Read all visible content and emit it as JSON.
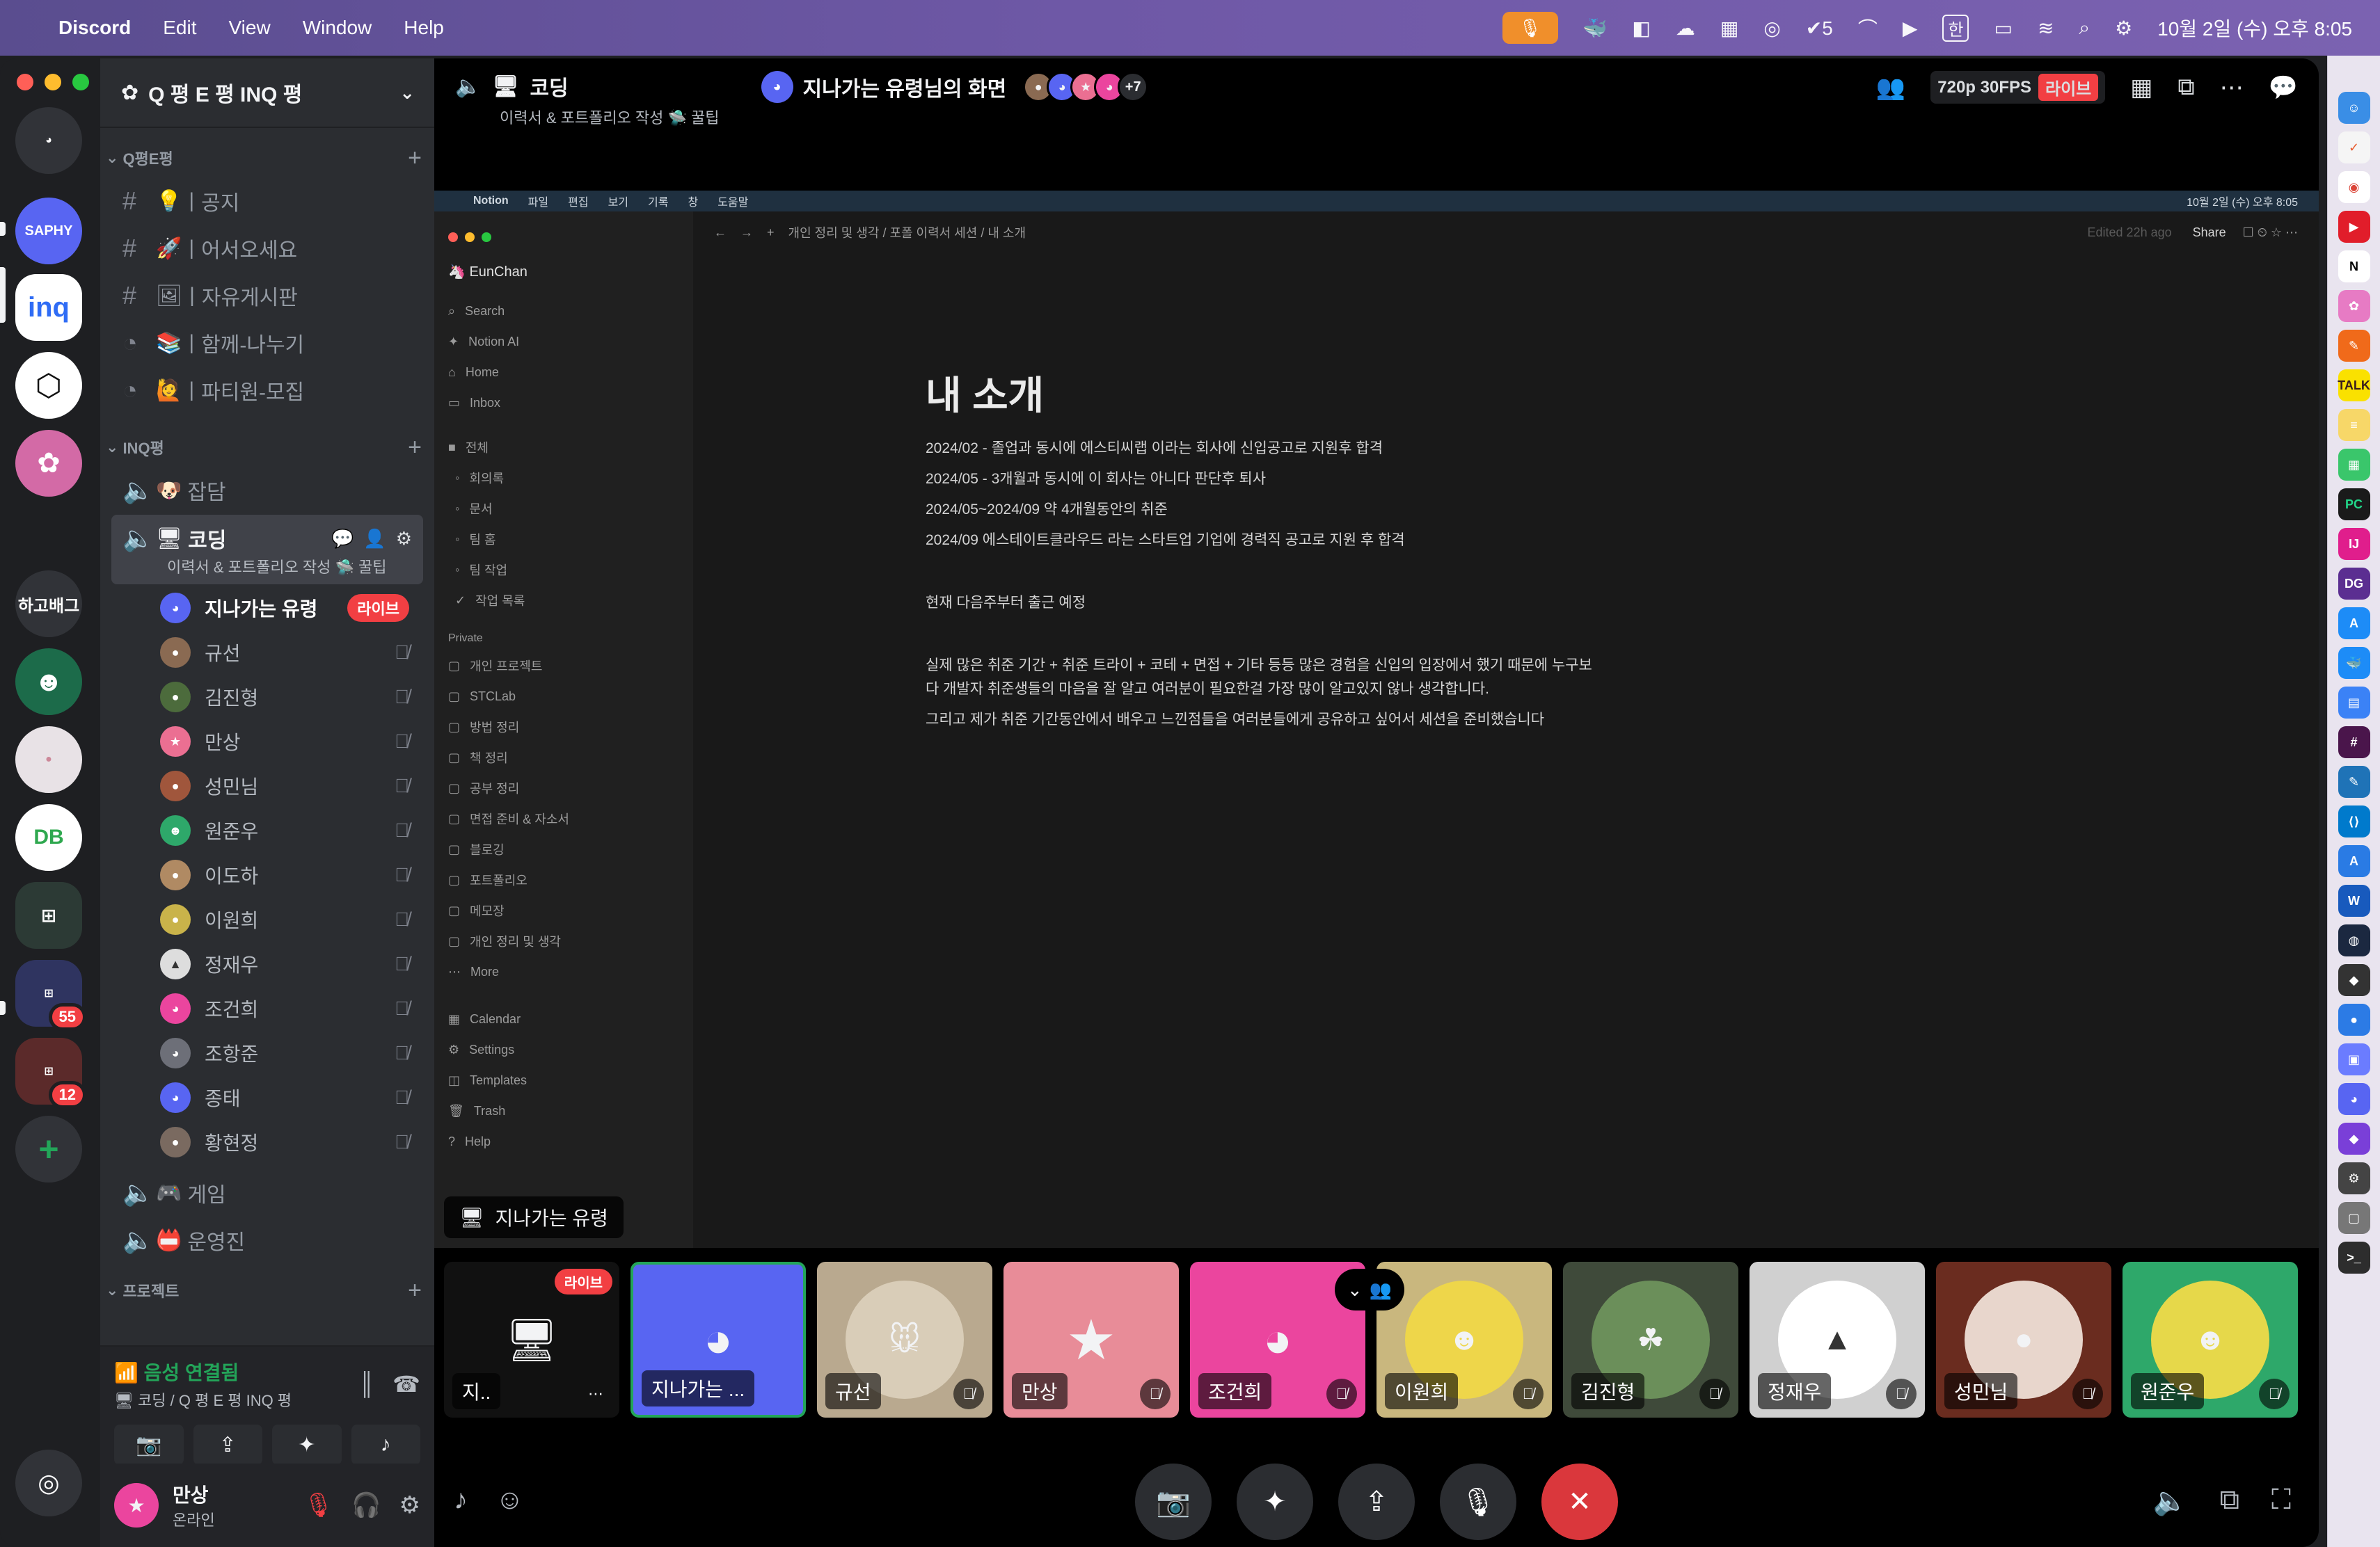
{
  "menubar": {
    "app": "Discord",
    "items": [
      "Edit",
      "View",
      "Window",
      "Help"
    ],
    "tray_count": "5",
    "input_source": "한",
    "clock": "10월 2일 (수) 오후 8:05"
  },
  "server": {
    "name": "Q 평 E 평 INQ 평"
  },
  "rail": {
    "sapphy": "SAPHY",
    "inq": "inq",
    "text_server": "하고배그",
    "badge_55": "55",
    "badge_12": "12"
  },
  "categories": {
    "qpe": "Q평E평",
    "inq": "INQ평",
    "project": "프로젝트"
  },
  "text_channels": [
    {
      "emoji": "💡",
      "name": "공지"
    },
    {
      "emoji": "🚀",
      "name": "어서오세요"
    },
    {
      "emoji": "🖼",
      "name": "자유게시판"
    },
    {
      "emoji": "📚",
      "name": "함께-나누기"
    },
    {
      "emoji": "🙋",
      "name": "파티원-모집"
    }
  ],
  "voice": {
    "chat": "잡담",
    "coding": "코딩",
    "coding_sub": "이력서 & 포트폴리오 작성 🛸 꿀팁",
    "game": "게임",
    "ops": "운영진"
  },
  "live_label": "라이브",
  "voice_users": [
    {
      "name": "지나가는 유령",
      "live": true
    },
    {
      "name": "규선"
    },
    {
      "name": "김진형"
    },
    {
      "name": "만상"
    },
    {
      "name": "성민님"
    },
    {
      "name": "원준우"
    },
    {
      "name": "이도하"
    },
    {
      "name": "이원희"
    },
    {
      "name": "정재우"
    },
    {
      "name": "조건희"
    },
    {
      "name": "조항준"
    },
    {
      "name": "종태"
    },
    {
      "name": "황현정"
    }
  ],
  "voice_panel": {
    "status": "음성 연결됨",
    "location": "코딩 / Q 평 E 평 INQ 평"
  },
  "user_panel": {
    "name": "만상",
    "status": "온라인"
  },
  "stage": {
    "channel": "코딩",
    "channel_sub": "이력서 & 포트폴리오 작성 🛸 꿀팁",
    "stream_title": "지나가는 유령님의 화면",
    "plus_count": "+7",
    "quality": "720p 30FPS",
    "presenter": "지나가는 유령"
  },
  "notion": {
    "menu": [
      "Notion",
      "파일",
      "편집",
      "보기",
      "기록",
      "창",
      "도움말"
    ],
    "clock": "10월 2일 (수) 오후 8:05",
    "workspace": "EunChan",
    "top_items": [
      "Search",
      "Notion AI",
      "Home",
      "Inbox"
    ],
    "team_items": [
      "전체",
      "회의록",
      "문서",
      "팀 홈",
      "팀 작업",
      "작업 목록"
    ],
    "private_label": "Private",
    "private_items": [
      "개인 프로젝트",
      "STCLab",
      "방법 정리",
      "책 정리",
      "공부 정리",
      "면접 준비 & 자소서",
      "블로깅",
      "포트폴리오",
      "메모장",
      "개인 정리 및 생각",
      "More"
    ],
    "bottom_items": [
      "Calendar",
      "Settings",
      "Templates",
      "Trash",
      "Help"
    ],
    "breadcrumb": "개인 정리 및 생각 / 포폴 이력서 세션 / 내 소개",
    "edited": "Edited 22h ago",
    "share": "Share",
    "title": "내 소개",
    "lines": [
      "2024/02 - 졸업과 동시에 에스티씨랩 이라는 회사에 신입공고로 지원후 합격",
      "2024/05 - 3개월과 동시에 이 회사는 아니다 판단후 퇴사",
      "2024/05~2024/09 약 4개월동안의 취준",
      "2024/09 에스테이트클라우드 라는 스타트업 기업에 경력직 공고로 지원 후 합격",
      "현재 다음주부터 출근 예정",
      "실제 많은 취준 기간 + 취준 트라이 + 코테 + 면접 + 기타 등등 많은 경험을 신입의 입장에서 했기 때문에 누구보",
      "다 개발자 취준생들의 마음을 잘 알고 여러분이 필요한걸 가장 많이 알고있지 않나 생각합니다.",
      "그리고 제가 취준 기간동안에서 배우고 느낀점들을 여러분들에게 공유하고 싶어서 세션을 준비했습니다"
    ]
  },
  "tiles": [
    {
      "name": "지..",
      "kind": "screen",
      "live": true
    },
    {
      "name": "지나가는 ...",
      "kind": "discord-blue"
    },
    {
      "name": "규선"
    },
    {
      "name": "만상"
    },
    {
      "name": "조건희"
    },
    {
      "name": "이원희"
    },
    {
      "name": "김진형"
    },
    {
      "name": "정재우"
    },
    {
      "name": "성민님"
    },
    {
      "name": "원준우"
    }
  ],
  "colors": {
    "blurple": "#5865f2",
    "live_red": "#f23f43",
    "green": "#23a559",
    "background": "#1e1f22",
    "sidebar": "#2b2d31"
  }
}
